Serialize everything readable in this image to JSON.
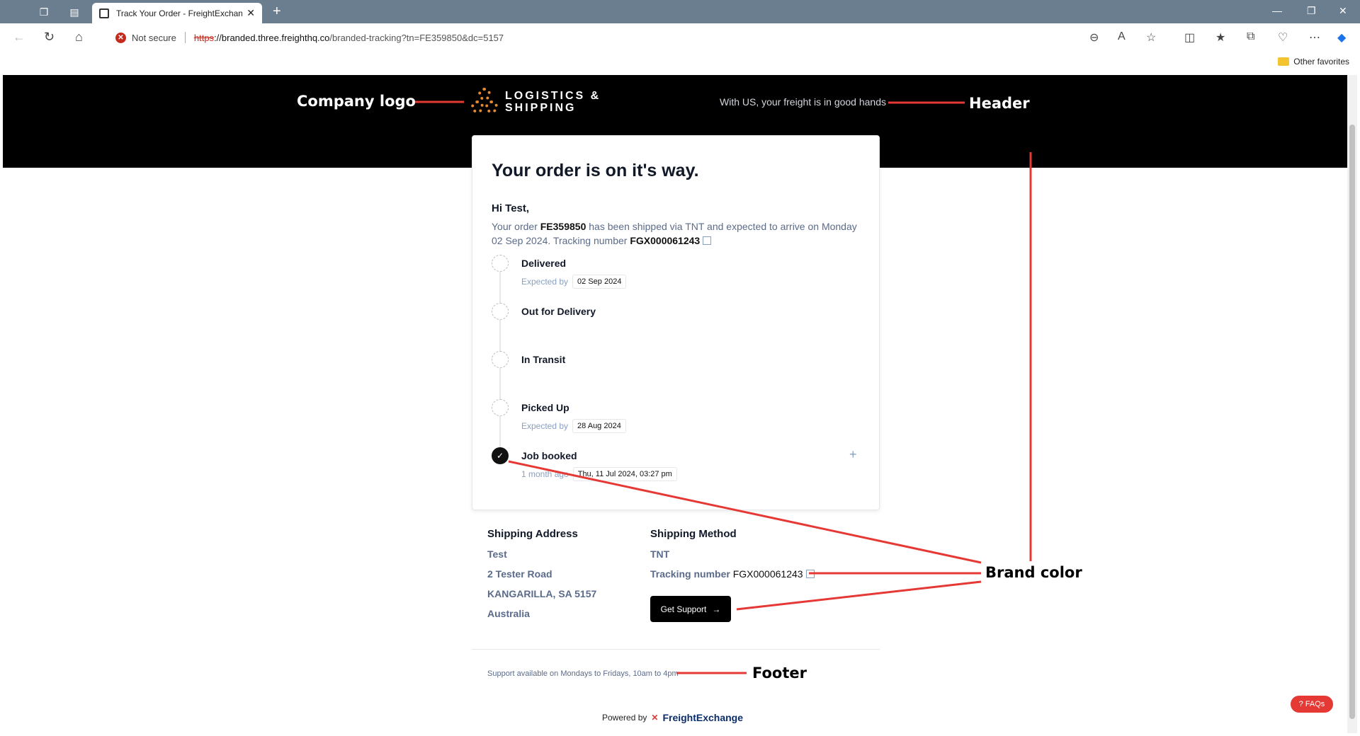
{
  "browser": {
    "tab_title": "Track Your Order - FreightExchan",
    "not_secure": "Not secure",
    "url_scheme": "https",
    "url_host": "://branded.three.freighthq.co",
    "url_path": "/branded-tracking?tn=FE359850&dc=5157",
    "other_favorites": "Other favorites"
  },
  "header": {
    "logo_line1": "LOGISTICS &",
    "logo_line2": "SHIPPING",
    "tagline": "With US, your freight is in good hands"
  },
  "card": {
    "title": "Your order is on it's way.",
    "greeting": "Hi Test,",
    "msg_prefix": "Your order ",
    "order_number": "FE359850",
    "msg_middle": " has been shipped via TNT and expected to arrive on Monday 02 Sep 2024. Tracking number ",
    "tracking_number": "FGX000061243"
  },
  "timeline": [
    {
      "name": "Delivered",
      "sub_label": "Expected by",
      "pill": "02 Sep 2024",
      "done": false
    },
    {
      "name": "Out for Delivery",
      "sub_label": "",
      "pill": "",
      "done": false
    },
    {
      "name": "In Transit",
      "sub_label": "",
      "pill": "",
      "done": false
    },
    {
      "name": "Picked Up",
      "sub_label": "Expected by",
      "pill": "28 Aug 2024",
      "done": false
    },
    {
      "name": "Job booked",
      "sub_label": "1 month ago",
      "pill": "Thu, 11 Jul 2024, 03:27 pm",
      "done": true
    }
  ],
  "shipping_address": {
    "title": "Shipping Address",
    "lines": [
      "Test",
      "2 Tester Road",
      "KANGARILLA, SA 5157",
      "Australia"
    ]
  },
  "shipping_method": {
    "title": "Shipping Method",
    "carrier": "TNT",
    "tracking_label": "Tracking number",
    "tracking_number": "FGX000061243",
    "support_button": "Get Support"
  },
  "footer": {
    "support_hours": "Support available on Mondays to Fridays, 10am to 4pm",
    "powered_by": "Powered by",
    "brand": "FreightExchange",
    "faqs": "FAQs"
  },
  "annotations": {
    "company_logo": "Company logo",
    "header": "Header",
    "brand_color": "Brand color",
    "footer": "Footer"
  },
  "colors": {
    "header_bg": "#000000",
    "accent_red": "#e53935",
    "logo_orange": "#e8892b",
    "text_muted": "#5b6b8a"
  }
}
